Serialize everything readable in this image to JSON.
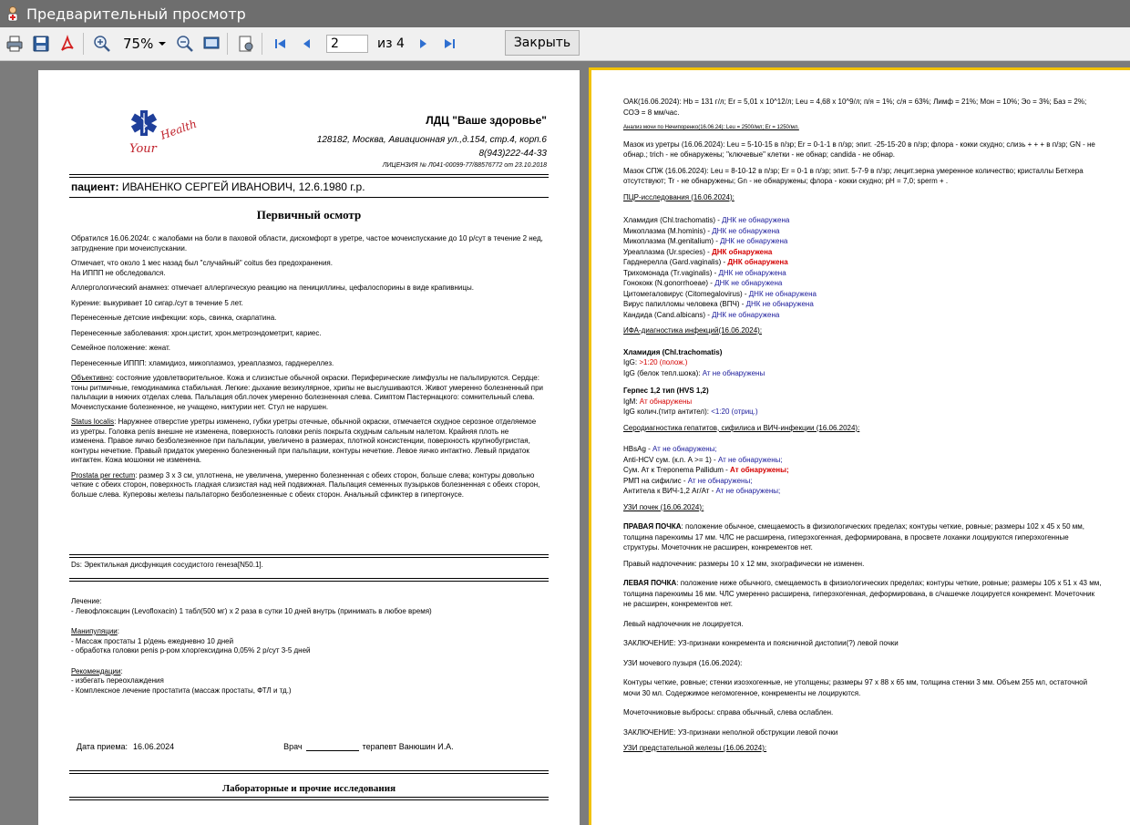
{
  "window": {
    "title": "Предварительный просмотр"
  },
  "toolbar": {
    "zoom": "75%",
    "page_current": "2",
    "page_of": "из 4",
    "close_label": "Закрыть"
  },
  "page1": {
    "clinic_name": "ЛДЦ \"Ваше здоровье\"",
    "clinic_address": "128182, Москва, Авиационная ул.,д.154, стр.4, корп.6",
    "clinic_phone": "8(943)222-44-33",
    "clinic_license": "ЛИЦЕНЗИЯ № Л041-00099-77/88576772 от 23.10.2018",
    "patient_label": "пациент:",
    "patient_name": "ИВАНЕНКО СЕРГЕЙ ИВАНОВИЧ, 12.6.1980 г.р.",
    "exam_title": "Первичный осмотр",
    "complaints": "Обратился 16.06.2024г. с жалобами на боли в паховой области, дискомфорт в уретре, частое мочеиспускание до 10 р/сут в течение 2 нед, затруднение при мочеиспускании.",
    "anamnesis_1": "Отмечает, что около 1 мес назад был \"случайный\" coitus без предохранения.",
    "anamnesis_2": "На ИППП не обследовался.",
    "allergy": "Аллергологический анамнез: отмечает аллергическую реакцию на пенициллины, цефалоспорины в виде крапивницы.",
    "smoking": "Курение: выкуривает 10 сигар./сут в течение 5 лет.",
    "child_inf": "Перенесенные детские инфекции: корь, свинка, скарлатина.",
    "diseases": "Перенесенные заболевания:  хрон.цистит,  хрон.метроэндометрит, кариес.",
    "family": "Семейное положение: женат.",
    "stis": "Перенесенные ИППП: хламидиоз, микоплазмоз, уреаплазмоз, гарднереллез.",
    "objective_label": "Объективно",
    "objective": ": состояние удовлетворительное. Кожа и слизистые обычной окраски. Периферические лимфузлы не пальпируются. Сердце: тоны ритмичные, гемодинамика стабильная. Легкие: дыхание везикулярное, хрипы не выслушиваются. Живот умеренно болезненный при пальпации в нижних отделах слева. Пальпация обл.почек умеренно болезненная слева. Симптом Пастернацкого: сомнительный слева. Мочеиспускание болезненное, не учащено, никтурии нет. Стул не нарушен.",
    "status_label": "Status localis",
    "status": ": Наружнее отверстие уретры изменено, губки уретры отечные, обычной окраски, отмечается скудное серозное отделяемое из уретры. Головка penis внешне не изменена, поверхность головки penis покрыта скудным сальным налетом. Крайняя плоть не изменена. Правое яичко безболезненное при пальпации, увеличено в размерах, плотной консистенции, поверхность крупнобугристая, контуры нечеткие. Правый придаток умеренно болезненный при пальпации, контуры нечеткие. Левое яичко интактно. Левый придаток интактен. Кожа мошонки не изменена.",
    "prostata_label": "Prostata per rectum",
    "prostata": ": размер 3 х 3 см, уплотнена, не увеличена, умеренно болезненная с обеих сторон, больше слева; контуры довольно четкие с обеих сторон, поверхность гладкая слизистая над ней подвижная. Пальпация семенных пузырьков болезненная с обеих сторон, больше слева. Куперовы железы пальпаторно безболезненные с обеих сторон. Анальный сфинктер в гипертонусе.",
    "ds": "Ds: Эректильная дисфункция сосудистого генеза[N50.1].",
    "treatment_label": "Лечение:",
    "treatment_1": "- Левофлоксацин (Levofloxacin) 1 табл(500 мг) х 2 раза в сутки 10 дней внутрь (принимать в любое время)",
    "manip_label": "Манипуляции",
    "manip_1": "- Массаж простаты 1 р/день ежедневно 10 дней",
    "manip_2": "- обработка головки penis р-ром хлоргексидина 0,05% 2 р/сут 3-5 дней",
    "recs_label": "Рекомендации",
    "recs_1": "- избегать переохлаждения",
    "recs_2": "- Комплексное лечение простатита (массаж простаты, ФТЛ и тд.)",
    "date_label": "Дата приема:",
    "date_value": "16.06.2024",
    "doctor_label": "Врач",
    "doctor_name": "терапевт Ванюшин И.А.",
    "lab_title": "Лабораторные и прочие исследования"
  },
  "page2": {
    "oak": "ОАК(16.06.2024): Hb = 131 г/л; Er = 5,01 х 10^12/л; Leu = 4,68 х 10^9/л; п/я = 1%; с/я = 63%; Лимф = 21%; Мон = 10%; Эо = 3%; Баз = 2%; СОЭ = 8 мм/час.",
    "nechip": "Анализ мочи по Нечипоренко(16.06.24): Leu = 2500/мл; Er = 1250/мл.",
    "urethra": "Мазок из уретры (16.06.2024): Leu = 5-10-15 в п/зр; Er = 0-1-1 в п/зр; эпит. -25-15-20 в п/зр; флора - кокки скудно; слизь + + + в п/зр; GN - не обнар.; trich - не обнаружены; \"ключевые\" клетки - не обнар; candida - не обнар.",
    "spzh": "Мазок СПЖ (16.06.2024): Leu = 8-10-12 в п/зр; Er = 0-1 в п/зр; эпит. 5-7-9 в п/зр; лецит.зерна умеренное количество; кристаллы Бетхера отсутствуют; Tr - не обнаружены; Gn - не обнаружены; флора - кокки скудно; pH = 7,0; sperm + .",
    "pcr_title": "ПЦР-исследования (16.06.2024):",
    "pcr": [
      {
        "name": "Хламидия (Chl.trachomatis) - ",
        "result": "ДНК не обнаружена",
        "pos": false
      },
      {
        "name": "Микоплазма (M.hominis) - ",
        "result": "ДНК не обнаружена",
        "pos": false
      },
      {
        "name": "Микоплазма (M.genitalium) - ",
        "result": "ДНК не обнаружена",
        "pos": false
      },
      {
        "name": "Уреаплазма (Ur.species) - ",
        "result": "ДНК обнаружена",
        "pos": true
      },
      {
        "name": "Гарднерелла (Gard.vaginalis) - ",
        "result": "ДНК обнаружена",
        "pos": true
      },
      {
        "name": "Трихомонада (Tr.vaginalis) - ",
        "result": "ДНК не обнаружена",
        "pos": false
      },
      {
        "name": "Гонококк (N.gonorrhoeae) - ",
        "result": "ДНК не обнаружена",
        "pos": false
      },
      {
        "name": "Цитомегаловирус (Citomegalovirus) - ",
        "result": "ДНК не обнаружена",
        "pos": false
      },
      {
        "name": "Вирус папилломы человека (ВПЧ) - ",
        "result": "ДНК не обнаружена",
        "pos": false
      },
      {
        "name": "Кандида (Cand.albicans) - ",
        "result": "ДНК не обнаружена",
        "pos": false
      }
    ],
    "ifa_title": "ИФА-диагностика инфекций(16.06.2024):",
    "chl_title": "Хламидия (Chl.trachomatis)",
    "chl_igg_label": "IgG: ",
    "chl_igg_value": ">1:20 (полож.)",
    "chl_igg_avid_label": "IgG (белок тепл.шока): ",
    "chl_igg_avid_value": "Ат не обнаружены",
    "herpes_title": "Герпес 1,2 тип (HVS 1,2)",
    "herpes_igm_label": "IgM: ",
    "herpes_igm_value": "Ат обнаружены",
    "herpes_igg_label": "IgG колич.(титр антител): ",
    "herpes_igg_value": "<1:20 (отриц.)",
    "sero_title": "Серодиагностика гепатитов, сифилиса и ВИЧ-инфекции (16.06.2024):",
    "sero": [
      {
        "name": "HBsAg - ",
        "result": "Ат не обнаружены;",
        "pos": false
      },
      {
        "name": "Anti-HCV сум. (к.п. А >= 1) - ",
        "result": "Ат не обнаружены;",
        "pos": false
      },
      {
        "name": "Сум. Ат к Treponema Pallidum - ",
        "result": "Ат обнаружены;",
        "pos": true
      },
      {
        "name": "РМП на сифилис - ",
        "result": "Ат не обнаружены;",
        "pos": false
      },
      {
        "name": "Антитела к ВИЧ-1,2 Аг/Ат - ",
        "result": "Ат не обнаружены;",
        "pos": false
      }
    ],
    "kidney_title": "УЗИ почек (16.06.2024):",
    "right_kidney_label": "ПРАВАЯ ПОЧКА",
    "right_kidney": ": положение обычное, смещаемость в физиологических пределах; контуры четкие, ровные; размеры 102 х 45 х 50 мм, толщина паренхимы 17 мм. ЧЛС не расширена, гиперэхогенная, деформирована, в просвете лоханки лоцируются гиперэхогенные структуры. Мочеточник не расширен, конкрементов нет.",
    "right_adrenal": "Правый надпочечник: размеры 10 х 12 мм, эхографически не изменен.",
    "left_kidney_label": "ЛЕВАЯ ПОЧКА",
    "left_kidney": ": положение ниже обычного, смещаемость в физиологических пределах; контуры четкие, ровные; размеры 105 х 51 х 43 мм, толщина паренхимы 16 мм. ЧЛС умеренно расширена, гиперэхогенная, деформирована, в с/чашечке лоцируется конкремент. Мочеточник не расширен, конкрементов нет.",
    "left_adrenal": "Левый надпочечник не лоцируется.",
    "kidney_concl": "ЗАКЛЮЧЕНИЕ: УЗ-признаки конкремента  и поясничной дистопии(?) левой почки",
    "bladder_title": "УЗИ мочевого пузыря (16.06.2024):",
    "bladder": "Контуры четкие, ровные; стенки изоэхогенные, не утолщены; размеры 97 х 88 х 65 мм, толщина стенки 3 мм. Объем 255 мл, остаточной мочи 30 мл. Содержимое негомогенное, конкременты не лоцируются.",
    "ureter": "Мочеточниковые выбросы: справа обычный, слева ослаблен.",
    "bladder_concl": "ЗАКЛЮЧЕНИЕ: УЗ-признаки неполной обструкции левой почки",
    "prostate_title": "УЗИ предстательной железы (16.06.2024):"
  },
  "colors": {
    "found": "#d40000",
    "not_found": "#1a1a9a",
    "highlight": "#f2c200"
  }
}
